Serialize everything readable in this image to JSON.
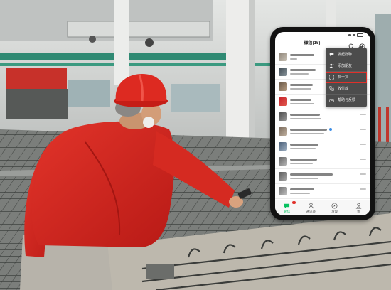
{
  "header": {
    "title": "微信(15)",
    "search_icon": "search-icon",
    "add_icon": "plus-circle-icon"
  },
  "menu": {
    "items": [
      {
        "label": "发起群聊",
        "icon": "group-chat-icon"
      },
      {
        "label": "添加朋友",
        "icon": "add-friend-icon"
      },
      {
        "label": "扫一扫",
        "icon": "scan-icon",
        "highlighted": true
      },
      {
        "label": "收付款",
        "icon": "payment-icon"
      },
      {
        "label": "帮助与反馈",
        "icon": "help-icon"
      }
    ]
  },
  "tabs": [
    {
      "label": "微信",
      "icon": "chat-icon",
      "active": true
    },
    {
      "label": "通讯录",
      "icon": "contacts-icon"
    },
    {
      "label": "发现",
      "icon": "compass-icon"
    },
    {
      "label": "我",
      "icon": "person-icon"
    }
  ],
  "colors": {
    "wechat_green": "#07c160",
    "menu_background": "#4c4c4c",
    "highlight_outline": "#e0302a",
    "uniform_red": "#d8261f"
  }
}
